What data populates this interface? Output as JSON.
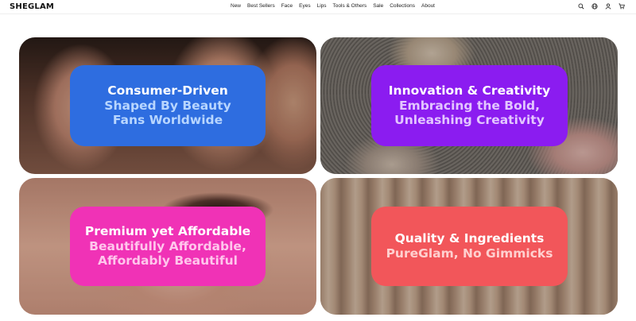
{
  "brand": {
    "logo_text": "SHEGLAM"
  },
  "nav": [
    "New",
    "Best Sellers",
    "Face",
    "Eyes",
    "Lips",
    "Tools & Others",
    "Sale",
    "Collections",
    "About"
  ],
  "header_icons": [
    "search-icon",
    "globe-icon",
    "user-icon",
    "cart-icon"
  ],
  "tiles": [
    {
      "title": "Consumer-Driven",
      "line2": "Shaped By Beauty",
      "line3": "Fans Worldwide",
      "card_color": "#2e6de0",
      "sub_color": "#b8d6ff",
      "image": "faces-of-models-photo"
    },
    {
      "title": "Innovation & Creativity",
      "line2": "Embracing the Bold,",
      "line3": "Unleashing Creativity",
      "card_color": "#8b1cf0",
      "sub_color": "#e3c6ff",
      "image": "compact-on-sand-photo"
    },
    {
      "title": "Premium yet Affordable",
      "line2": "Beautifully Affordable,",
      "line3": "Affordably Beautiful",
      "card_color": "#f032b6",
      "sub_color": "#ffc6ec",
      "image": "eye-closeup-photo"
    },
    {
      "title": "Quality & Ingredients",
      "line2": "PureGlam, No Gimmicks",
      "line3": "",
      "card_color": "#f2565a",
      "sub_color": "#ffd0cf",
      "image": "product-tubes-photo"
    }
  ]
}
